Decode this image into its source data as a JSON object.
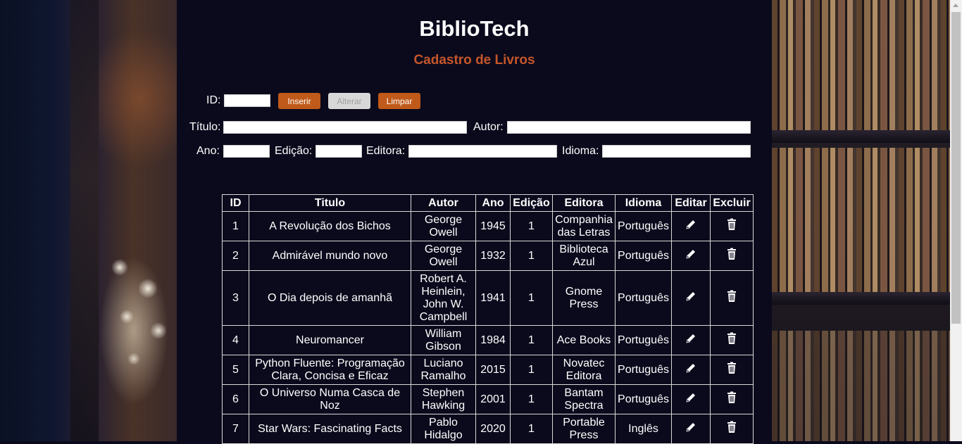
{
  "header": {
    "title": "BiblioTech",
    "subtitle": "Cadastro de Livros"
  },
  "form": {
    "id_label": "ID:",
    "id_value": "",
    "insert_label": "Inserir",
    "alter_label": "Alterar",
    "clear_label": "Limpar",
    "title_label": "Título:",
    "title_value": "",
    "author_label": "Autor:",
    "author_value": "",
    "year_label": "Ano:",
    "year_value": "",
    "edition_label": "Edição:",
    "edition_value": "",
    "publisher_label": "Editora:",
    "publisher_value": "",
    "language_label": "Idioma:",
    "language_value": ""
  },
  "table": {
    "columns": [
      "ID",
      "Titulo",
      "Autor",
      "Ano",
      "Edição",
      "Editora",
      "Idioma",
      "Editar",
      "Excluir"
    ],
    "rows": [
      {
        "id": "1",
        "title": "A Revolução dos Bichos",
        "author": "George Owell",
        "year": "1945",
        "edition": "1",
        "publisher": "Companhia das Letras",
        "language": "Português"
      },
      {
        "id": "2",
        "title": "Admirável mundo novo",
        "author": "George Owell",
        "year": "1932",
        "edition": "1",
        "publisher": "Biblioteca Azul",
        "language": "Português"
      },
      {
        "id": "3",
        "title": "O Dia depois de amanhã",
        "author": "Robert A. Heinlein, John W. Campbell",
        "year": "1941",
        "edition": "1",
        "publisher": "Gnome Press",
        "language": "Português"
      },
      {
        "id": "4",
        "title": "Neuromancer",
        "author": "William Gibson",
        "year": "1984",
        "edition": "1",
        "publisher": "Ace Books",
        "language": "Português"
      },
      {
        "id": "5",
        "title": "Python Fluente: Programação Clara, Concisa e Eficaz",
        "author": "Luciano Ramalho",
        "year": "2015",
        "edition": "1",
        "publisher": "Novatec Editora",
        "language": "Português"
      },
      {
        "id": "6",
        "title": "O Universo Numa Casca de Noz",
        "author": "Stephen Hawking",
        "year": "2001",
        "edition": "1",
        "publisher": "Bantam Spectra",
        "language": "Português"
      },
      {
        "id": "7",
        "title": "Star Wars: Fascinating Facts",
        "author": "Pablo Hidalgo",
        "year": "2020",
        "edition": "1",
        "publisher": "Portable Press",
        "language": "Inglês"
      }
    ],
    "edit_icon": "pencil-icon",
    "delete_icon": "trash-icon"
  },
  "colors": {
    "page_background": "#0b0a1c",
    "subtitle": "#c5562a",
    "button": "#c05a1a",
    "button_disabled": "#d8d8d8"
  }
}
